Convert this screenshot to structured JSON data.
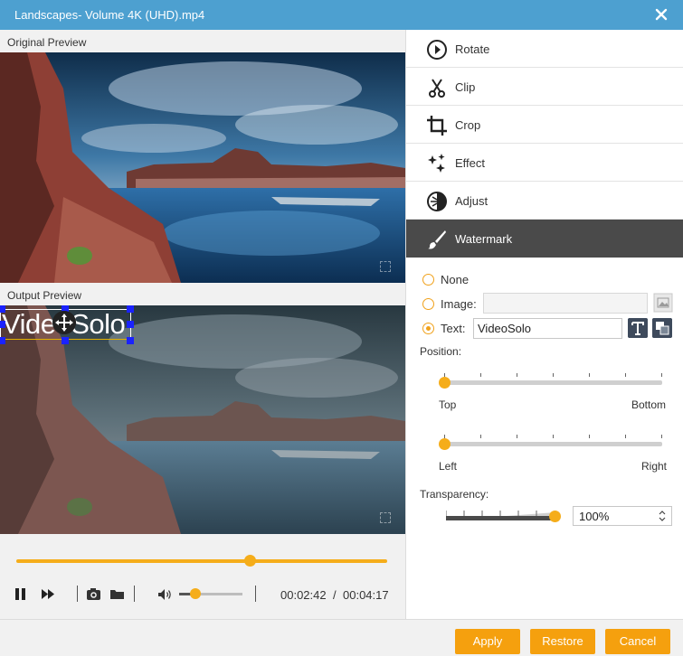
{
  "window": {
    "title": "Landscapes- Volume 4K (UHD).mp4",
    "close_icon": "close-icon"
  },
  "previews": {
    "original_label": "Original Preview",
    "output_label": "Output Preview",
    "watermark_text": "VideoSolo"
  },
  "player": {
    "seek_progress": 0.63,
    "volume_level": 0.25,
    "current_time": "00:02:42",
    "time_separator": "/",
    "total_time": "00:04:17",
    "icons": [
      "pause-icon",
      "fast-forward-icon",
      "camera-icon",
      "folder-icon",
      "volume-icon"
    ]
  },
  "menu": {
    "items": [
      {
        "label": "Rotate",
        "icon": "rotate-icon"
      },
      {
        "label": "Clip",
        "icon": "scissors-icon"
      },
      {
        "label": "Crop",
        "icon": "crop-icon"
      },
      {
        "label": "Effect",
        "icon": "sparkle-icon"
      },
      {
        "label": "Adjust",
        "icon": "adjust-icon"
      },
      {
        "label": "Watermark",
        "icon": "brush-icon",
        "active": true
      }
    ]
  },
  "watermark": {
    "none_label": "None",
    "image_label": "Image:",
    "image_value": "",
    "text_label": "Text:",
    "text_value": "VideoSolo",
    "selected": "text",
    "position_label": "Position:",
    "vertical": {
      "start": "Top",
      "end": "Bottom",
      "value": 0
    },
    "horizontal": {
      "start": "Left",
      "end": "Right",
      "value": 0
    },
    "transparency_label": "Transparency:",
    "transparency_level": 1.0,
    "transparency_value": "100%"
  },
  "footer": {
    "apply_label": "Apply",
    "restore_label": "Restore",
    "cancel_label": "Cancel"
  },
  "colors": {
    "titlebar": "#4da0d0",
    "accent": "#f5a00e",
    "active_menu": "#4a4a4a"
  }
}
